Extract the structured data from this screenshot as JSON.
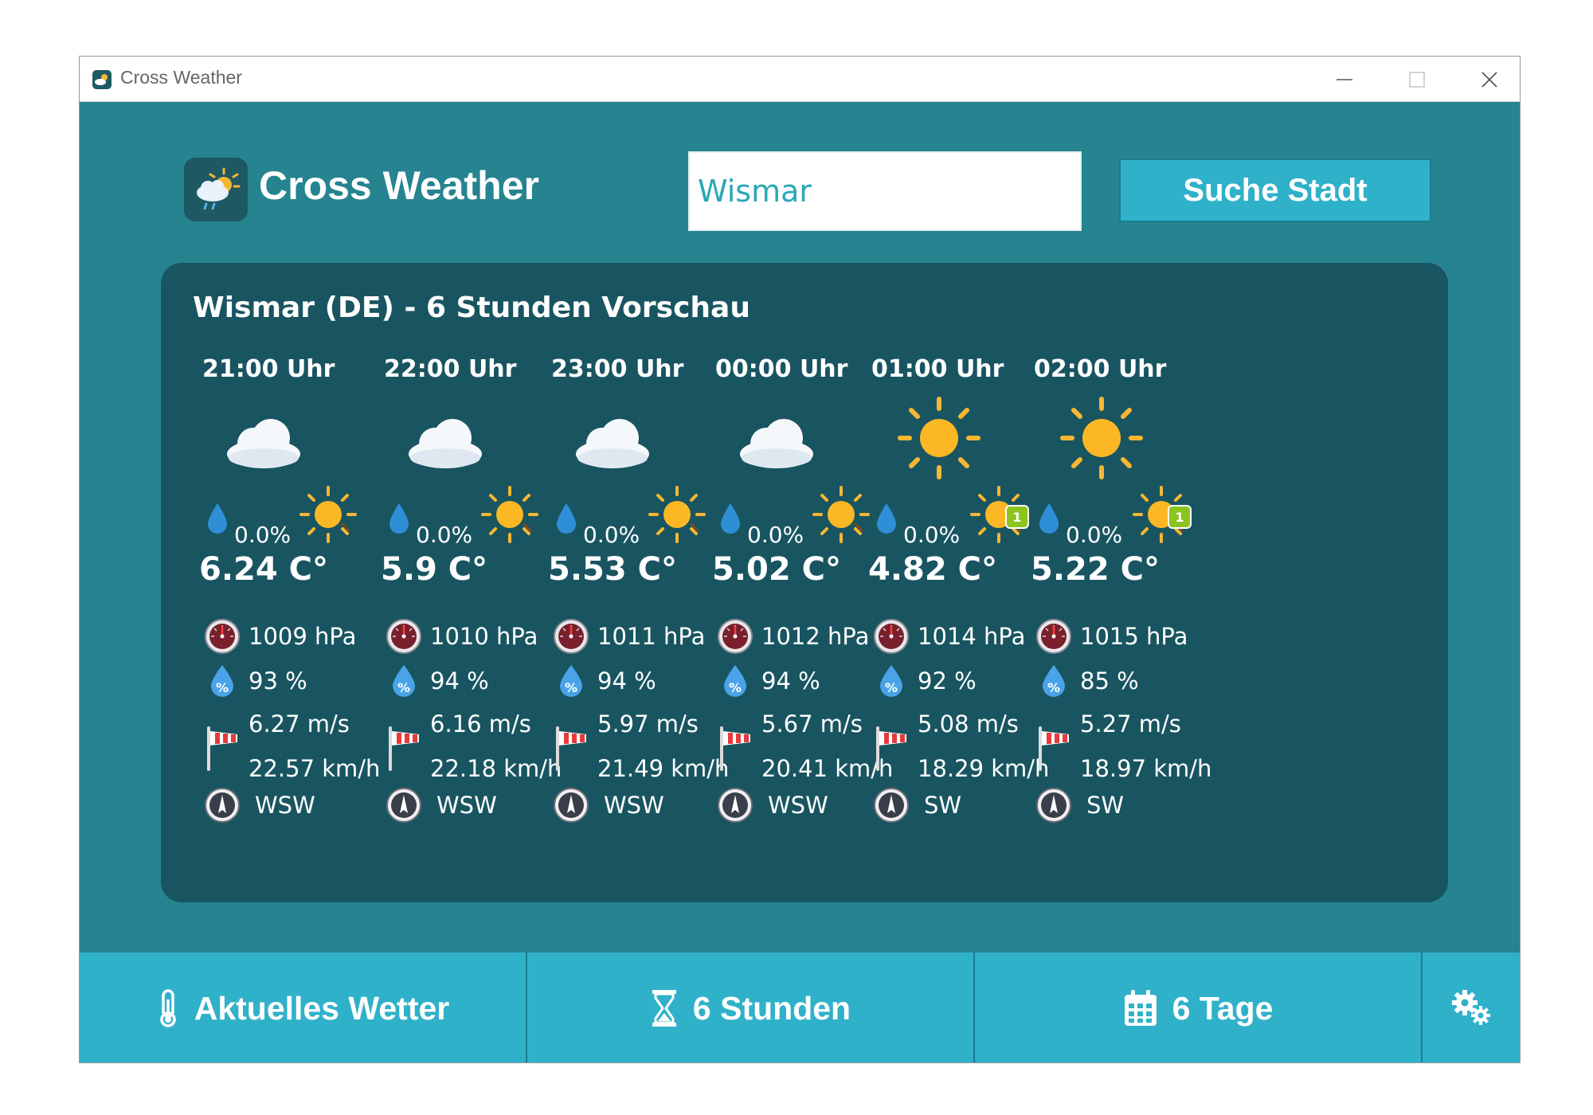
{
  "window": {
    "title": "Cross Weather"
  },
  "header": {
    "app_title": "Cross Weather"
  },
  "search": {
    "value": "Wismar",
    "button_label": "Suche Stadt"
  },
  "forecast": {
    "title": "Wismar (DE) - 6 Stunden Vorschau",
    "hours": [
      {
        "time": "21:00 Uhr",
        "condition": "cloud-icon",
        "rain": "0.0%",
        "uv_badge": "",
        "temp": "6.24 C°",
        "pressure": "1009 hPa",
        "humidity": "93 %",
        "wind_ms": "6.27 m/s",
        "wind_kmh": "22.57 km/h",
        "direction": "WSW"
      },
      {
        "time": "22:00 Uhr",
        "condition": "cloud-icon",
        "rain": "0.0%",
        "uv_badge": "",
        "temp": "5.9 C°",
        "pressure": "1010 hPa",
        "humidity": "94 %",
        "wind_ms": "6.16 m/s",
        "wind_kmh": "22.18 km/h",
        "direction": "WSW"
      },
      {
        "time": "23:00 Uhr",
        "condition": "cloud-icon",
        "rain": "0.0%",
        "uv_badge": "",
        "temp": "5.53 C°",
        "pressure": "1011 hPa",
        "humidity": "94 %",
        "wind_ms": "5.97 m/s",
        "wind_kmh": "21.49 km/h",
        "direction": "WSW"
      },
      {
        "time": "00:00 Uhr",
        "condition": "cloud-icon",
        "rain": "0.0%",
        "uv_badge": "",
        "temp": "5.02 C°",
        "pressure": "1012 hPa",
        "humidity": "94 %",
        "wind_ms": "5.67 m/s",
        "wind_kmh": "20.41 km/h",
        "direction": "WSW"
      },
      {
        "time": "01:00 Uhr",
        "condition": "sun-icon",
        "rain": "0.0%",
        "uv_badge": "1",
        "temp": "4.82 C°",
        "pressure": "1014 hPa",
        "humidity": "92 %",
        "wind_ms": "5.08 m/s",
        "wind_kmh": "18.29 km/h",
        "direction": "SW"
      },
      {
        "time": "02:00 Uhr",
        "condition": "sun-icon",
        "rain": "0.0%",
        "uv_badge": "1",
        "temp": "5.22 C°",
        "pressure": "1015 hPa",
        "humidity": "85 %",
        "wind_ms": "5.27 m/s",
        "wind_kmh": "18.97 km/h",
        "direction": "SW"
      }
    ]
  },
  "nav": {
    "current_label": "Aktuelles Wetter",
    "hours_label": "6 Stunden",
    "days_label": "6 Tage"
  },
  "colors": {
    "window_bg": "#25848f",
    "panel_bg": "#195561",
    "button_bg": "#30b1ca",
    "accent_border": "#1a7d8e"
  }
}
